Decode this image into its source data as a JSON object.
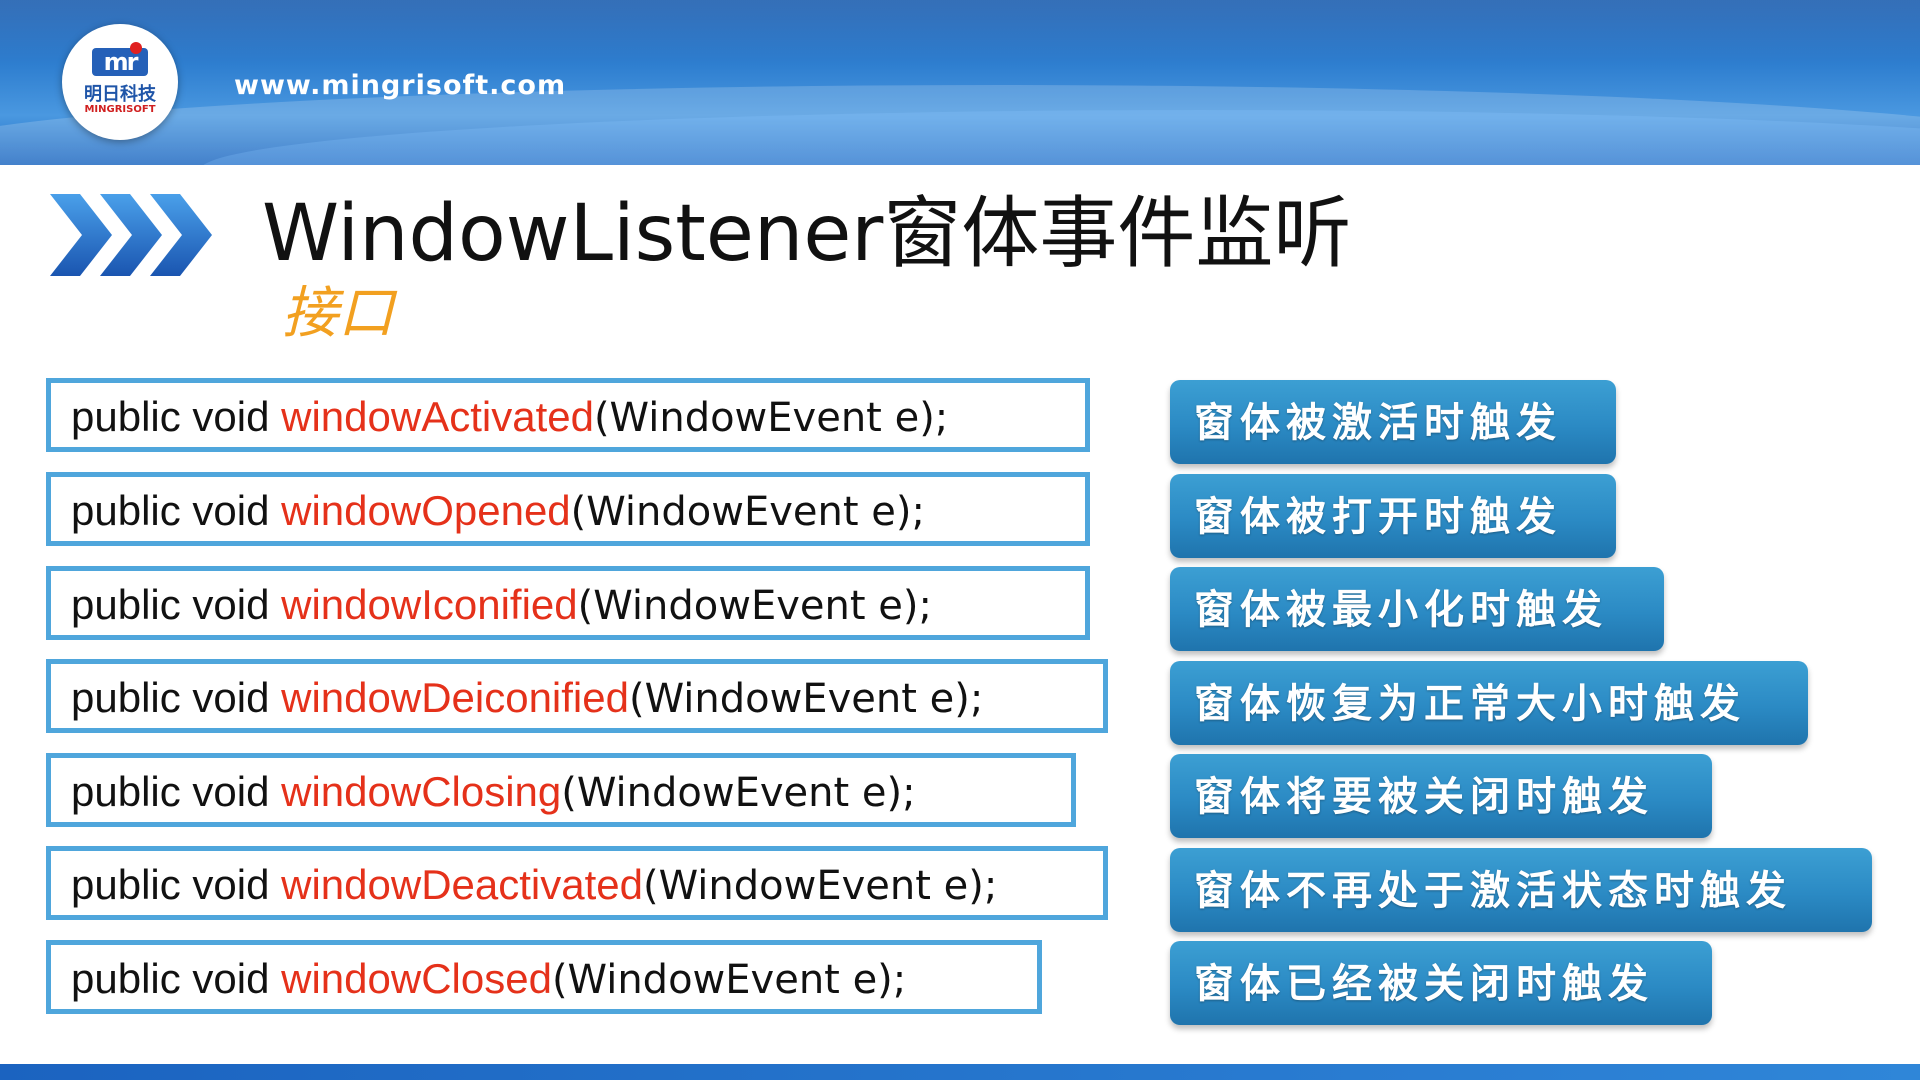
{
  "header": {
    "site_url": "www.mingrisoft.com",
    "logo": {
      "mark": "mr",
      "cn_name": "明日科技",
      "en_name": "MINGRISOFT"
    }
  },
  "slide": {
    "title": "WindowListener窗体事件监听",
    "subtitle": "接口"
  },
  "methods": [
    {
      "prefix": "public void ",
      "name": "windowActivated",
      "params": "(WindowEvent e);",
      "description": "窗体被激活时触发"
    },
    {
      "prefix": "public void ",
      "name": "windowOpened",
      "params": "(WindowEvent e);",
      "description": "窗体被打开时触发"
    },
    {
      "prefix": "public void ",
      "name": "windowIconified",
      "params": "(WindowEvent e);",
      "description": "窗体被最小化时触发"
    },
    {
      "prefix": "public void ",
      "name": "windowDeiconified",
      "params": "(WindowEvent e);",
      "description": "窗体恢复为正常大小时触发"
    },
    {
      "prefix": "public void ",
      "name": "windowClosing",
      "params": "(WindowEvent e);",
      "description": "窗体将要被关闭时触发"
    },
    {
      "prefix": "public void ",
      "name": "windowDeactivated",
      "params": "(WindowEvent e);",
      "description": "窗体不再处于激活状态时触发"
    },
    {
      "prefix": "public void ",
      "name": "windowClosed",
      "params": "(WindowEvent e);",
      "description": "窗体已经被关闭时触发"
    }
  ],
  "colors": {
    "method_name": "#e5311a",
    "box_border": "#4fa6dc",
    "button_blue": "#2b8ac4",
    "subtitle_orange": "#f2a020",
    "header_blue": "#2f7fd0"
  }
}
